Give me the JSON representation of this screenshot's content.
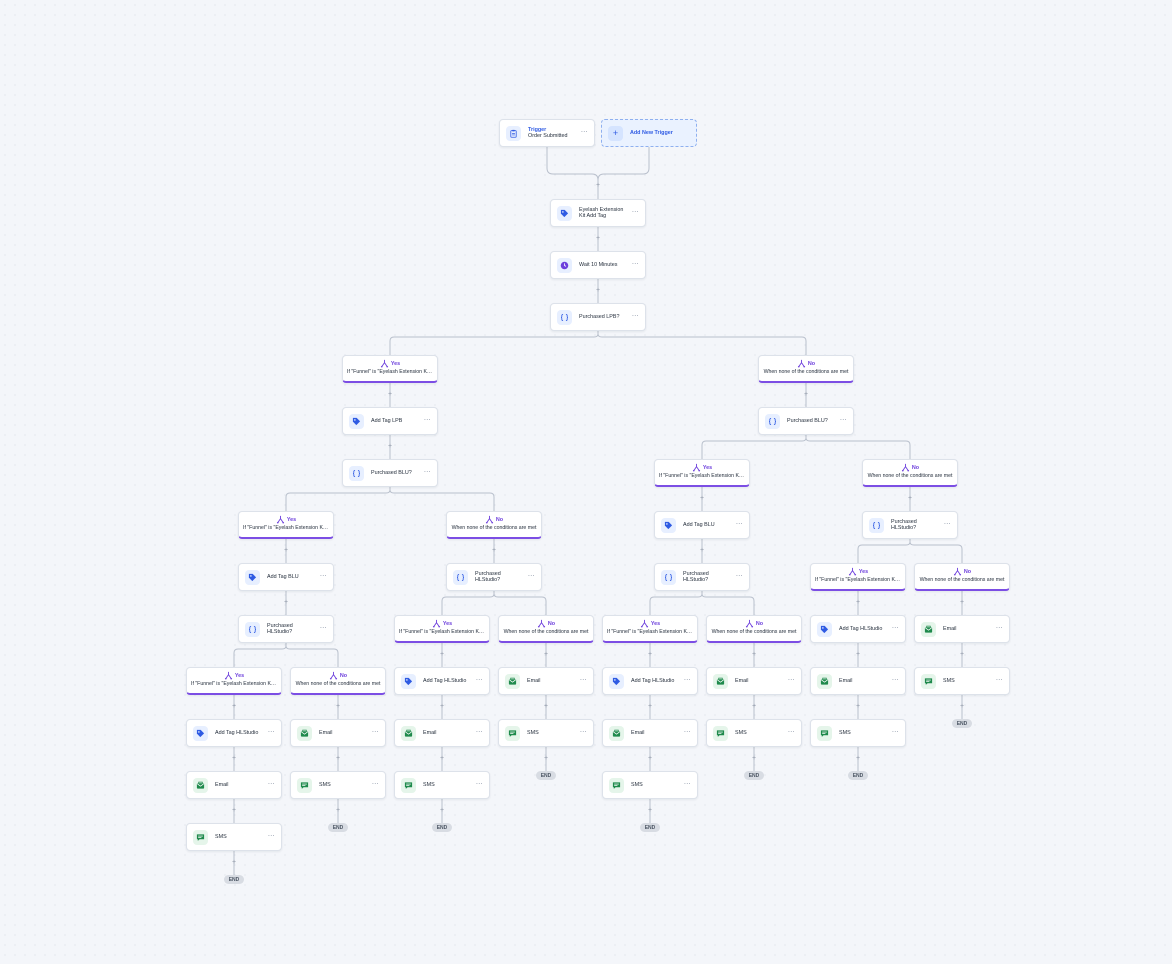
{
  "labels": {
    "trigger_title": "Trigger",
    "trigger_value": "Order Submitted",
    "add_trigger": "Add New Trigger",
    "more": "⋯",
    "end": "END",
    "yes": "Yes",
    "no": "No",
    "cond_yes": "If \"Funnel\" is \"Eyelash Extension Kit...",
    "cond_no": "When none of the conditions are met"
  },
  "icons": {
    "trigger": "clipboard-icon",
    "tag": "tag-icon",
    "wait": "clock-icon",
    "condition": "braces-icon",
    "email": "email-icon",
    "sms": "sms-icon",
    "branch": "split-icon",
    "add": "plus-icon"
  },
  "colors": {
    "accent_blue": "#2f5be3",
    "branch_purple": "#7c4ee4",
    "green": "#1f8a4c",
    "wait_purple": "#6d3fdc"
  },
  "steps": [
    {
      "label": "Eyelash Extension Kit Add Tag",
      "icon": "tag-icon"
    },
    {
      "label": "Wait 10 Minutes",
      "icon": "clock-icon"
    },
    {
      "label": "Purchased LPB?",
      "icon": "braces-icon"
    },
    {
      "label": "Add Tag LPB",
      "icon": "tag-icon"
    },
    {
      "label": "Purchased BLU?",
      "icon": "braces-icon"
    },
    {
      "label": "Add Tag BLU",
      "icon": "tag-icon"
    },
    {
      "label": "Purchased HLStudio?",
      "icon": "braces-icon"
    },
    {
      "label": "Add Tag HLStudio",
      "icon": "tag-icon"
    },
    {
      "label": "Email",
      "icon": "email-icon"
    },
    {
      "label": "SMS",
      "icon": "sms-icon"
    }
  ]
}
